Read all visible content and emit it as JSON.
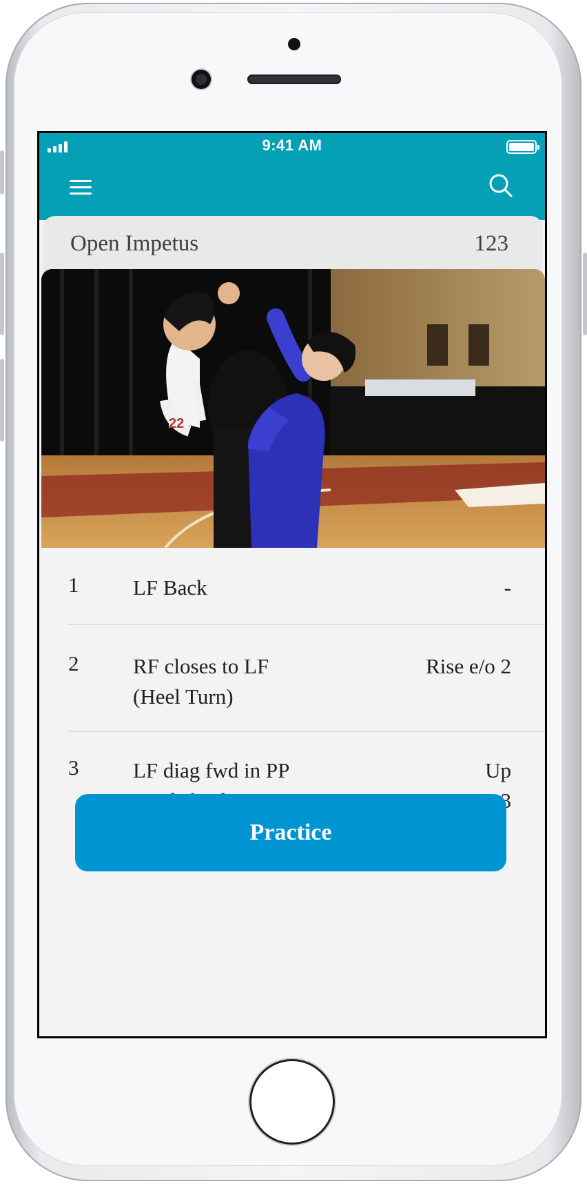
{
  "status_bar": {
    "time": "9:41 AM"
  },
  "header": {
    "menu_icon": "hamburger-menu-icon",
    "search_icon": "search-icon",
    "accent_color": "#03a0b6"
  },
  "figure": {
    "title": "Open Impetus",
    "count": "123"
  },
  "photo": {
    "description_icon": "ballroom-dance-photo"
  },
  "steps": [
    {
      "number": "1",
      "description": [
        "LF Back"
      ],
      "note": [
        "-"
      ]
    },
    {
      "number": "2",
      "description": [
        "RF closes to LF",
        "(Heel Turn)"
      ],
      "note": [
        "Rise e/o 2"
      ]
    },
    {
      "number": "3",
      "description": [
        "LF diag fwd in PP",
        "L side leading"
      ],
      "note": [
        "Up",
        "Lower e/o 3"
      ]
    }
  ],
  "actions": {
    "practice_label": "Practice",
    "practice_color": "#0095d2"
  }
}
